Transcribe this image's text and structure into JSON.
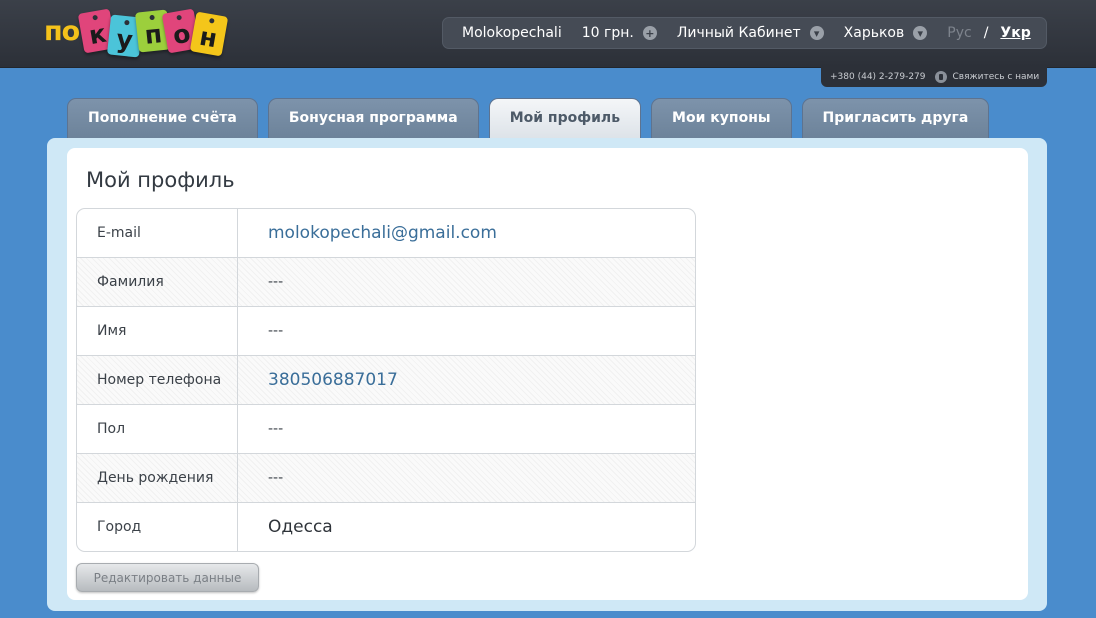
{
  "header": {
    "logo": {
      "prefix": "по",
      "tags": [
        "к",
        "у",
        "п",
        "о",
        "н"
      ],
      "colors": [
        "#e0457b",
        "#4bc4d9",
        "#9ccf3c",
        "#f4c61a"
      ]
    },
    "user": "Molokopechali",
    "balance": "10 грн.",
    "cabinet": "Личный Кабинет",
    "city": "Харьков",
    "lang_ru": "Рус",
    "lang_sep": "/",
    "lang_ua": "Укр",
    "phone": "+380 (44) 2-279-279",
    "contact": "Свяжитесь с нами"
  },
  "tabs": [
    {
      "label": "Пополнение счёта",
      "active": false
    },
    {
      "label": "Бонусная программа",
      "active": false
    },
    {
      "label": "Мой профиль",
      "active": true
    },
    {
      "label": "Мои купоны",
      "active": false
    },
    {
      "label": "Пригласить друга",
      "active": false
    }
  ],
  "profile": {
    "title": "Мой профиль",
    "rows": [
      {
        "label": "E-mail",
        "value": "molokopechali@gmail.com"
      },
      {
        "label": "Фамилия",
        "value": "---"
      },
      {
        "label": "Имя",
        "value": "---"
      },
      {
        "label": "Номер телефона",
        "value": "380506887017"
      },
      {
        "label": "Пол",
        "value": "---"
      },
      {
        "label": "День рождения",
        "value": "---"
      },
      {
        "label": "Город",
        "value": "Одесса"
      }
    ],
    "edit_button": "Редактировать данные"
  },
  "colors": {
    "background": "#4a8ccc",
    "topbar": "#2c3038",
    "link": "#3a6e99",
    "tab": "#7d93ab"
  }
}
